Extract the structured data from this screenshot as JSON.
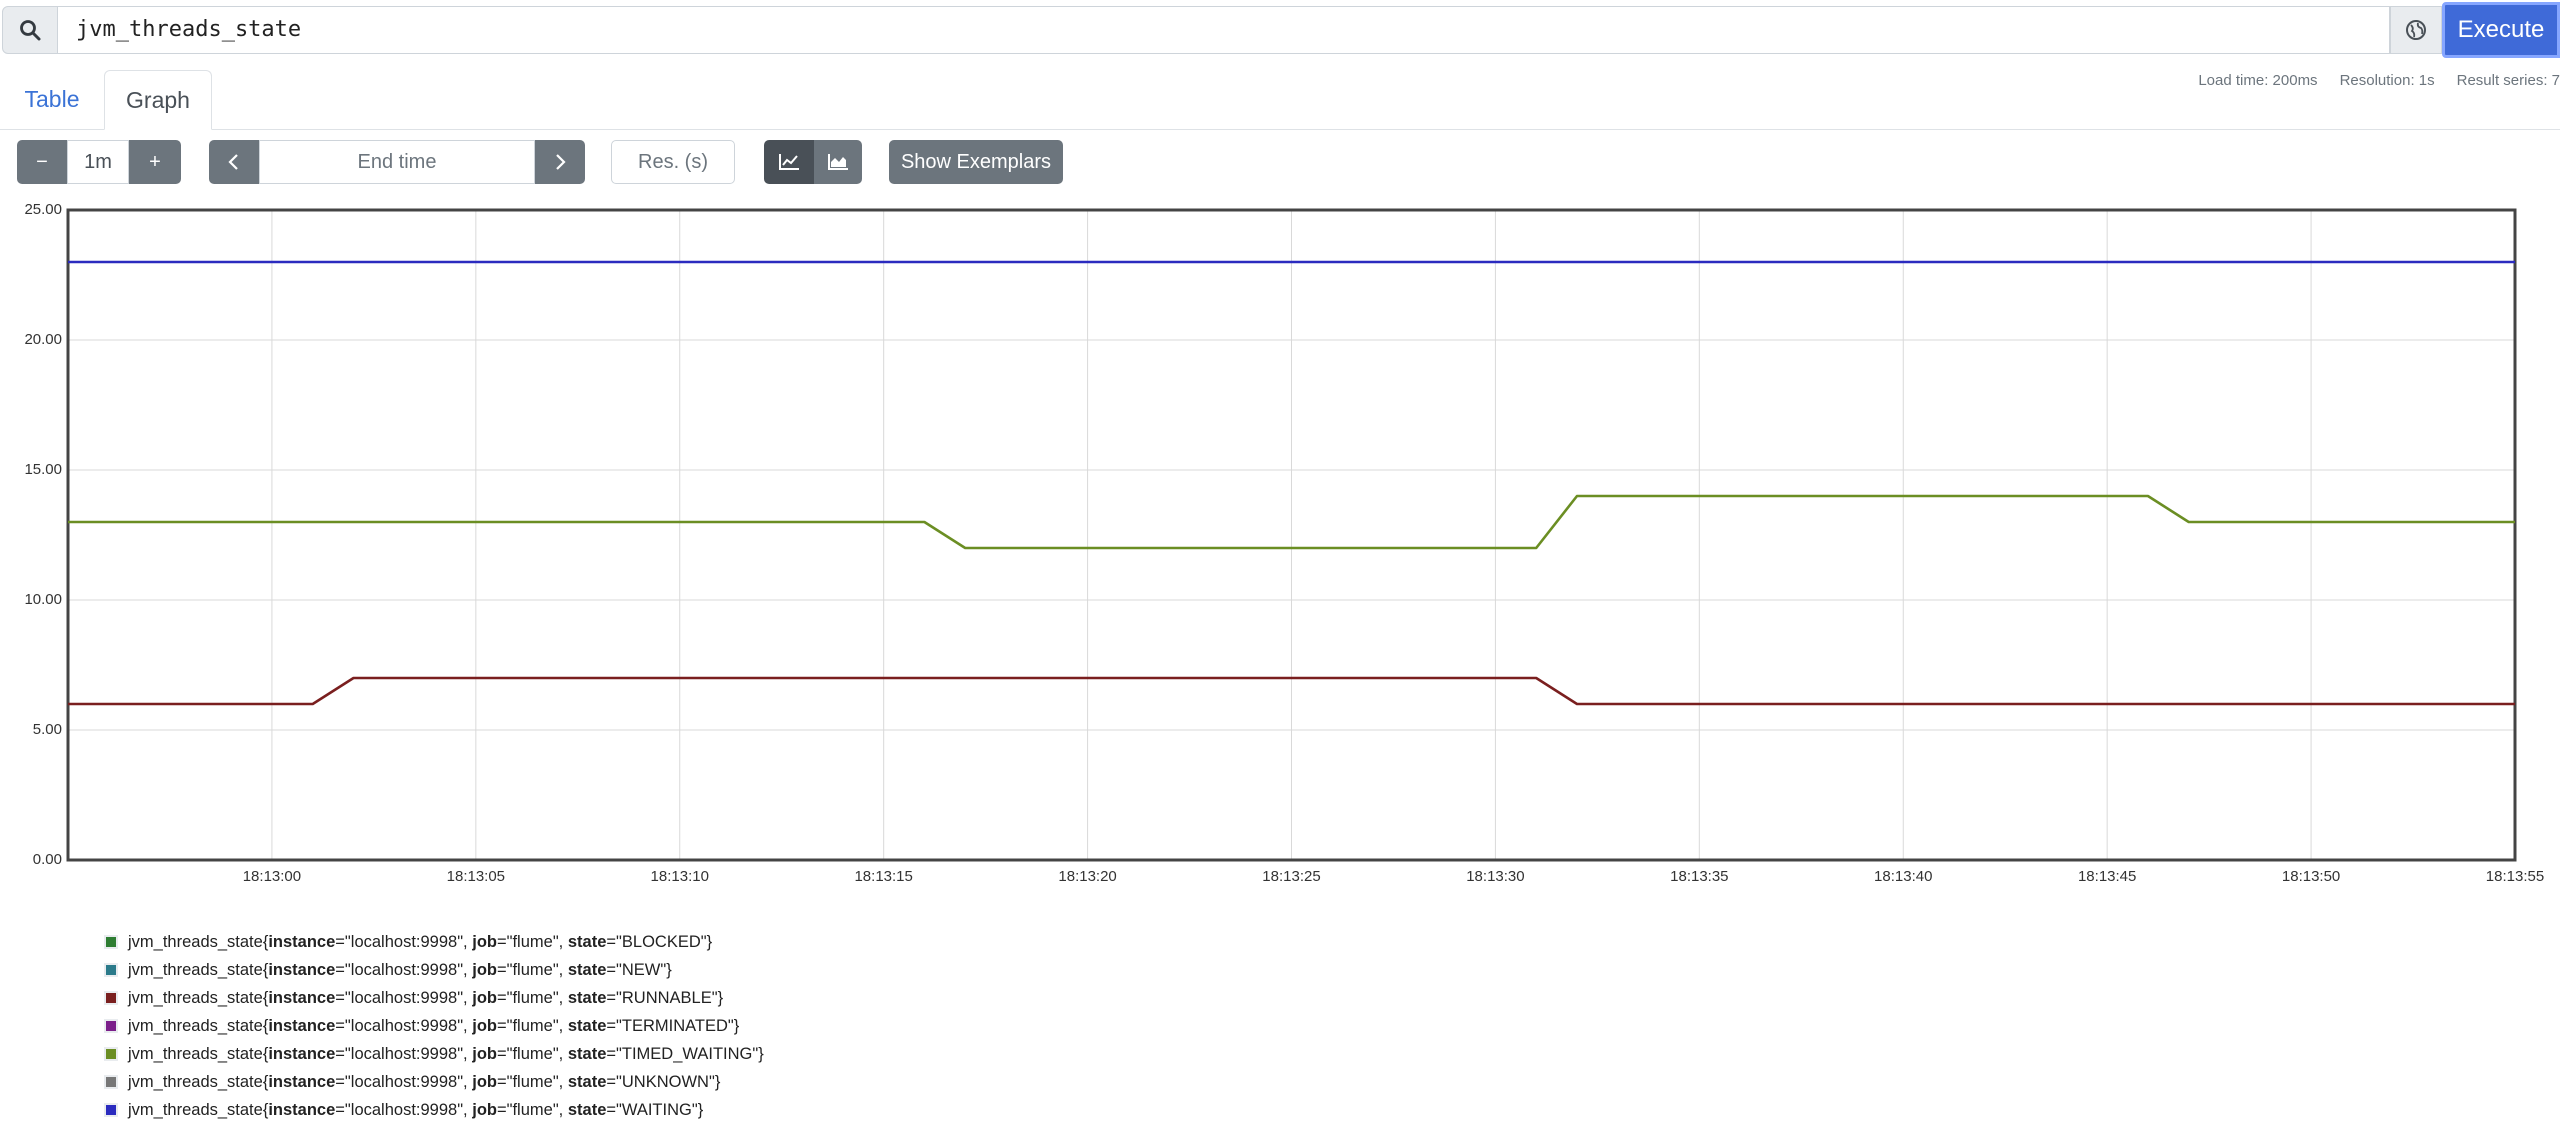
{
  "query": {
    "value": "jvm_threads_state",
    "execute_label": "Execute"
  },
  "tabs": {
    "table": "Table",
    "graph": "Graph"
  },
  "stats": {
    "load_time": "Load time: 200ms",
    "resolution": "Resolution: 1s",
    "result_series": "Result series: 7"
  },
  "controls": {
    "minus": "−",
    "range": "1m",
    "plus": "+",
    "prev": "‹",
    "end_time_placeholder": "End time",
    "next": "›",
    "res_placeholder": "Res. (s)",
    "show_exemplars": "Show Exemplars",
    "line_icon": "line-chart-icon",
    "stacked_icon": "area-chart-icon"
  },
  "chart_data": {
    "type": "line",
    "ylim": [
      0,
      25
    ],
    "yticks": [
      "0.00",
      "5.00",
      "10.00",
      "15.00",
      "20.00",
      "25.00"
    ],
    "xlim": [
      "18:12:55",
      "18:13:55"
    ],
    "xticks": [
      "18:13:00",
      "18:13:05",
      "18:13:10",
      "18:13:15",
      "18:13:20",
      "18:13:25",
      "18:13:30",
      "18:13:35",
      "18:13:40",
      "18:13:45",
      "18:13:50",
      "18:13:55"
    ],
    "grid": true,
    "series": [
      {
        "name": "jvm_threads_state{instance=\"localhost:9998\", job=\"flume\", state=\"BLOCKED\"}",
        "color": "#2e7d32",
        "points": []
      },
      {
        "name": "jvm_threads_state{instance=\"localhost:9998\", job=\"flume\", state=\"NEW\"}",
        "color": "#2b7a8a",
        "points": []
      },
      {
        "name": "jvm_threads_state{instance=\"localhost:9998\", job=\"flume\", state=\"RUNNABLE\"}",
        "color": "#7a1f1f",
        "points": [
          [
            "18:12:55",
            6
          ],
          [
            "18:13:01",
            6
          ],
          [
            "18:13:02",
            7
          ],
          [
            "18:13:31",
            7
          ],
          [
            "18:13:32",
            6
          ],
          [
            "18:13:55",
            6
          ]
        ]
      },
      {
        "name": "jvm_threads_state{instance=\"localhost:9998\", job=\"flume\", state=\"TERMINATED\"}",
        "color": "#7b1f8a",
        "points": []
      },
      {
        "name": "jvm_threads_state{instance=\"localhost:9998\", job=\"flume\", state=\"TIMED_WAITING\"}",
        "color": "#6b8e23",
        "points": [
          [
            "18:12:55",
            13
          ],
          [
            "18:13:16",
            13
          ],
          [
            "18:13:17",
            12
          ],
          [
            "18:13:31",
            12
          ],
          [
            "18:13:32",
            14
          ],
          [
            "18:13:46",
            14
          ],
          [
            "18:13:47",
            13
          ],
          [
            "18:13:55",
            13
          ]
        ]
      },
      {
        "name": "jvm_threads_state{instance=\"localhost:9998\", job=\"flume\", state=\"UNKNOWN\"}",
        "color": "#777777",
        "points": []
      },
      {
        "name": "jvm_threads_state{instance=\"localhost:9998\", job=\"flume\", state=\"WAITING\"}",
        "color": "#2b2bbf",
        "points": [
          [
            "18:12:55",
            23
          ],
          [
            "18:13:55",
            23
          ]
        ]
      }
    ]
  },
  "legend": [
    {
      "metric": "jvm_threads_state",
      "instance": "\"localhost:9998\"",
      "job": "\"flume\"",
      "state": "\"BLOCKED\"",
      "color": "#2e7d32"
    },
    {
      "metric": "jvm_threads_state",
      "instance": "\"localhost:9998\"",
      "job": "\"flume\"",
      "state": "\"NEW\"",
      "color": "#2b7a8a"
    },
    {
      "metric": "jvm_threads_state",
      "instance": "\"localhost:9998\"",
      "job": "\"flume\"",
      "state": "\"RUNNABLE\"",
      "color": "#7a1f1f"
    },
    {
      "metric": "jvm_threads_state",
      "instance": "\"localhost:9998\"",
      "job": "\"flume\"",
      "state": "\"TERMINATED\"",
      "color": "#7b1f8a"
    },
    {
      "metric": "jvm_threads_state",
      "instance": "\"localhost:9998\"",
      "job": "\"flume\"",
      "state": "\"TIMED_WAITING\"",
      "color": "#6b8e23"
    },
    {
      "metric": "jvm_threads_state",
      "instance": "\"localhost:9998\"",
      "job": "\"flume\"",
      "state": "\"UNKNOWN\"",
      "color": "#777777"
    },
    {
      "metric": "jvm_threads_state",
      "instance": "\"localhost:9998\"",
      "job": "\"flume\"",
      "state": "\"WAITING\"",
      "color": "#2b2bbf"
    }
  ]
}
